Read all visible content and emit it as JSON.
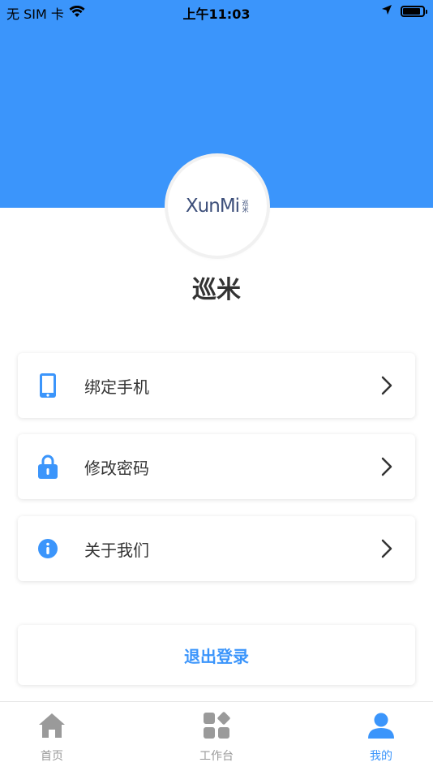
{
  "status_bar": {
    "carrier": "无 SIM 卡",
    "time": "上午11:03",
    "icons": [
      "wifi-icon",
      "location-arrow-icon",
      "battery-icon"
    ]
  },
  "profile": {
    "logo_text": "XunMi",
    "logo_cn": "巡米",
    "name": "巡米"
  },
  "menu": {
    "items": [
      {
        "label": "绑定手机",
        "icon": "phone-icon"
      },
      {
        "label": "修改密码",
        "icon": "lock-icon"
      },
      {
        "label": "关于我们",
        "icon": "info-icon"
      }
    ]
  },
  "logout": {
    "label": "退出登录"
  },
  "tabbar": {
    "tabs": [
      {
        "label": "首页",
        "icon": "home-icon",
        "active": false
      },
      {
        "label": "工作台",
        "icon": "workbench-icon",
        "active": false
      },
      {
        "label": "我的",
        "icon": "user-icon",
        "active": true
      }
    ]
  },
  "colors": {
    "primary": "#3b95fb",
    "inactive": "#999999"
  }
}
